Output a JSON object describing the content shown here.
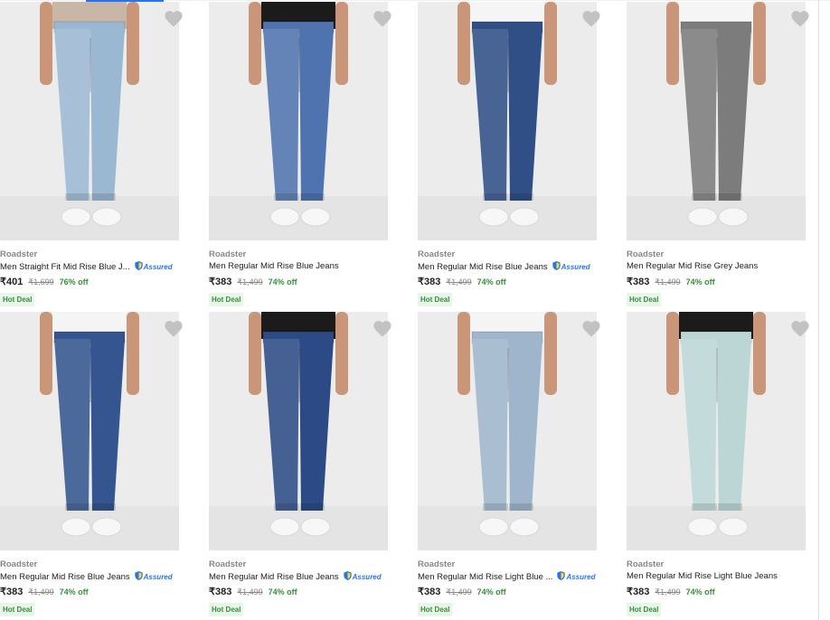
{
  "currency": "₹",
  "products": [
    {
      "brand": "Roadster",
      "title": "Men Straight Fit Mid Rise Blue J...",
      "assured": true,
      "price": "₹401",
      "mrp": "₹1,699",
      "discount": "76% off",
      "deal": "Hot Deal",
      "jeans_color": "#9bb8d3",
      "top_color": "#c8b6a6"
    },
    {
      "brand": "Roadster",
      "title": "Men Regular Mid Rise Blue Jeans",
      "assured": false,
      "price": "₹383",
      "mrp": "₹1,499",
      "discount": "74% off",
      "deal": "Hot Deal",
      "jeans_color": "#4f73ae",
      "top_color": "#1b1b1b"
    },
    {
      "brand": "Roadster",
      "title": "Men Regular Mid Rise Blue Jeans",
      "assured": true,
      "price": "₹383",
      "mrp": "₹1,499",
      "discount": "74% off",
      "deal": "Hot Deal",
      "jeans_color": "#2f4f86",
      "top_color": "#f5f5f5"
    },
    {
      "brand": "Roadster",
      "title": "Men Regular Mid Rise Grey Jeans",
      "assured": false,
      "price": "₹383",
      "mrp": "₹1,499",
      "discount": "74% off",
      "deal": "Hot Deal",
      "jeans_color": "#7c7c7c",
      "top_color": "#f5f5f5"
    },
    {
      "brand": "Roadster",
      "title": "Men Regular Mid Rise Blue Jeans",
      "assured": true,
      "price": "₹383",
      "mrp": "₹1,499",
      "discount": "74% off",
      "deal": "Hot Deal",
      "jeans_color": "#34558f",
      "top_color": "#f5f5f5"
    },
    {
      "brand": "Roadster",
      "title": "Men Regular Mid Rise Blue Jeans",
      "assured": true,
      "price": "₹383",
      "mrp": "₹1,499",
      "discount": "74% off",
      "deal": "Hot Deal",
      "jeans_color": "#2c4a85",
      "top_color": "#1b1b1b"
    },
    {
      "brand": "Roadster",
      "title": "Men Regular Mid Rise Light Blue ...",
      "assured": true,
      "price": "₹383",
      "mrp": "₹1,499",
      "discount": "74% off",
      "deal": "Hot Deal",
      "jeans_color": "#9fb5cc",
      "top_color": "#f5f5f5"
    },
    {
      "brand": "Roadster",
      "title": "Men Regular Mid Rise Light Blue Jeans",
      "assured": false,
      "price": "₹383",
      "mrp": "₹1,499",
      "discount": "74% off",
      "deal": "Hot Deal",
      "jeans_color": "#bcd6d6",
      "top_color": "#1b1b1b"
    }
  ],
  "icons": {
    "wishlist": "heart-icon",
    "assured": "shield-icon"
  },
  "assured_label": "Assured",
  "colors": {
    "accent": "#2874f0",
    "discount": "#388e3c",
    "deal_bg": "#e8f5e9",
    "heart": "#c2c2c2"
  }
}
